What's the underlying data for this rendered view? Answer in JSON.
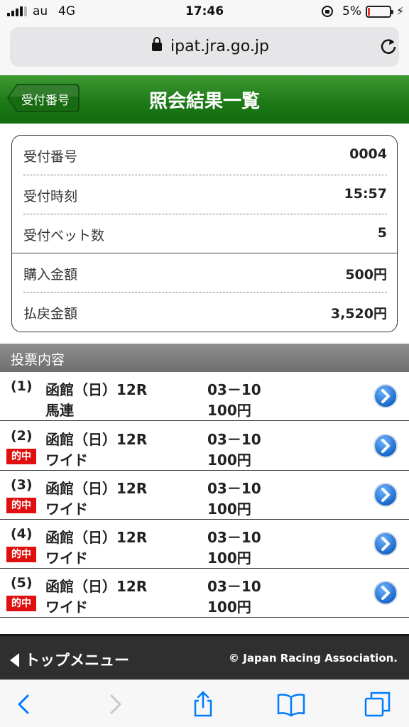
{
  "status_bar": {
    "carrier": "au",
    "network": "4G",
    "time": "17:46",
    "battery_percent": "5%",
    "battery_level": 0.05
  },
  "browser": {
    "url": "ipat.jra.go.jp"
  },
  "header": {
    "back_label": "受付番号",
    "title": "照会結果一覧"
  },
  "summary": {
    "rows": [
      {
        "label": "受付番号",
        "value": "0004"
      },
      {
        "label": "受付時刻",
        "value": "15:57"
      },
      {
        "label": "受付ベット数",
        "value": "5"
      },
      {
        "label": "購入金額",
        "value": "500円"
      },
      {
        "label": "払戻金額",
        "value": "3,520円"
      }
    ]
  },
  "section": {
    "title": "投票内容"
  },
  "bets": [
    {
      "index": "(1)",
      "race": "函館（日）12R",
      "type": "馬連",
      "combo": "03－10",
      "amount": "100円",
      "hit": ""
    },
    {
      "index": "(2)",
      "race": "函館（日）12R",
      "type": "ワイド",
      "combo": "03－10",
      "amount": "100円",
      "hit": "的中"
    },
    {
      "index": "(3)",
      "race": "函館（日）12R",
      "type": "ワイド",
      "combo": "03－10",
      "amount": "100円",
      "hit": "的中"
    },
    {
      "index": "(4)",
      "race": "函館（日）12R",
      "type": "ワイド",
      "combo": "03－10",
      "amount": "100円",
      "hit": "的中"
    },
    {
      "index": "(5)",
      "race": "函館（日）12R",
      "type": "ワイド",
      "combo": "03－10",
      "amount": "100円",
      "hit": "的中"
    }
  ],
  "footer": {
    "top_menu": "トップメニュー",
    "copyright": "© Japan Racing Association."
  },
  "colors": {
    "header_green": "#1d7a17",
    "hit_red": "#e01010",
    "arrow_blue": "#1a6fd0",
    "ios_blue": "#007aff"
  }
}
